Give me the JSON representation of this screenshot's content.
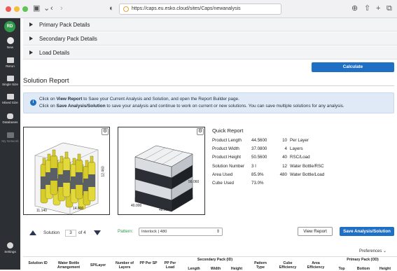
{
  "browser": {
    "url": "https://caps.eu.esko.cloud/sites/Caps/newanalysis"
  },
  "sidebar": {
    "avatar": "RD",
    "items": [
      {
        "label": "New"
      },
      {
        "label": "Rerun"
      },
      {
        "label": "Single Size"
      },
      {
        "label": "Mixed Size"
      },
      {
        "label": "Databases"
      },
      {
        "label": "My Network"
      },
      {
        "label": "Settings"
      }
    ]
  },
  "accordion": [
    {
      "label": "Primary Pack Details"
    },
    {
      "label": "Secondary Pack Details"
    },
    {
      "label": "Load Details"
    }
  ],
  "calculate_label": "Calculate",
  "solution_report": {
    "title": "Solution Report",
    "info_line1_a": "Click on ",
    "info_line1_b": "View Report",
    "info_line1_c": " to Save your Current Analysis and Solution, and open the Report Builder page.",
    "info_line2_a": "Click on ",
    "info_line2_b": "Save Analysis/Solution",
    "info_line2_c": " to save your analysis and continue to work on current or new solutions. You can save multiple solutions for any analysis."
  },
  "pack_image": {
    "dim_height": "12.460",
    "dim_width": "11.140",
    "dim_length": "14.800"
  },
  "pallet_image": {
    "dim_height": "56.060",
    "dim_width": "40.000",
    "dim_length": "48.000"
  },
  "quick_report": {
    "title": "Quick Report",
    "rows": [
      {
        "label": "Product Length",
        "value": "44.5600",
        "count": "10",
        "unit": "Per Layer"
      },
      {
        "label": "Product Width",
        "value": "37.0800",
        "count": "4",
        "unit": "Layers"
      },
      {
        "label": "Product Height",
        "value": "50.5600",
        "count": "40",
        "unit": "RSC/Load"
      },
      {
        "label": "Solution Number",
        "value": "3 I",
        "count": "12",
        "unit": "Water Bottle/RSC"
      },
      {
        "label": "Area Used",
        "value": "85.9%",
        "count": "480",
        "unit": "Water Bottle/Load"
      },
      {
        "label": "Cube Used",
        "value": "73.0%",
        "count": "",
        "unit": ""
      }
    ]
  },
  "pager": {
    "label": "Solution",
    "current": "3",
    "of": "of 4"
  },
  "pattern": {
    "label": "Pattern:",
    "value": "Interlock | 480"
  },
  "view_report_label": "View Report",
  "save_label": "Save Analysis/Solution",
  "preferences_label": "Preferences",
  "table": {
    "headers": [
      "Solution ID",
      "Water Bottle Arrangement",
      "SP/Layer",
      "Number of Layers",
      "PP Per SP",
      "PP Per Load",
      "Secondary Pack (ID)",
      "Pattern Type",
      "Cube Efficiency",
      "Area Efficiency",
      "Primary Pack (OD)"
    ],
    "sub_headers": [
      "Length",
      "Width",
      "Height",
      "Top",
      "Bottom",
      "Height"
    ]
  }
}
